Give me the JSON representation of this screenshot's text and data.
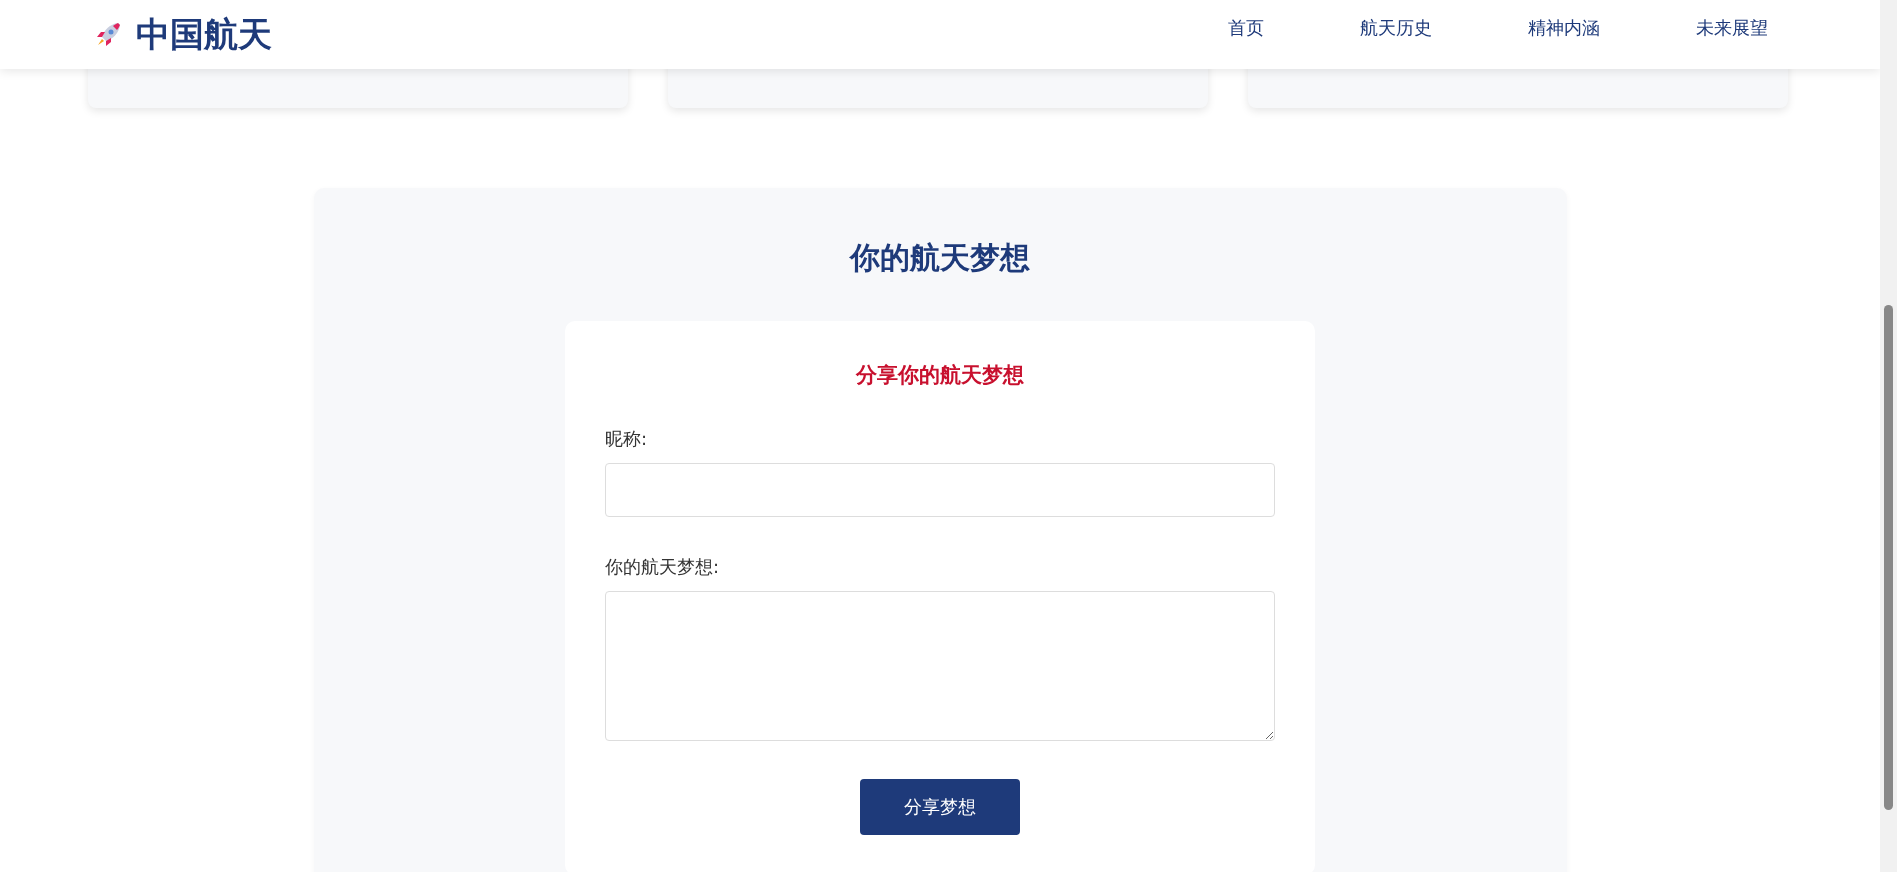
{
  "header": {
    "logo": "中国航天",
    "nav": [
      "首页",
      "航天历史",
      "精神内涵",
      "未来展望"
    ]
  },
  "cards": [
    {
      "kind": "card"
    },
    {
      "kind": "card"
    },
    {
      "kind": "card"
    }
  ],
  "dream_section": {
    "title": "你的航天梦想",
    "form": {
      "title": "分享你的航天梦想",
      "fields": [
        {
          "kind": "input",
          "label": "昵称:"
        },
        {
          "kind": "textarea",
          "label": "你的航天梦想:"
        }
      ],
      "submit": "分享梦想"
    }
  }
}
